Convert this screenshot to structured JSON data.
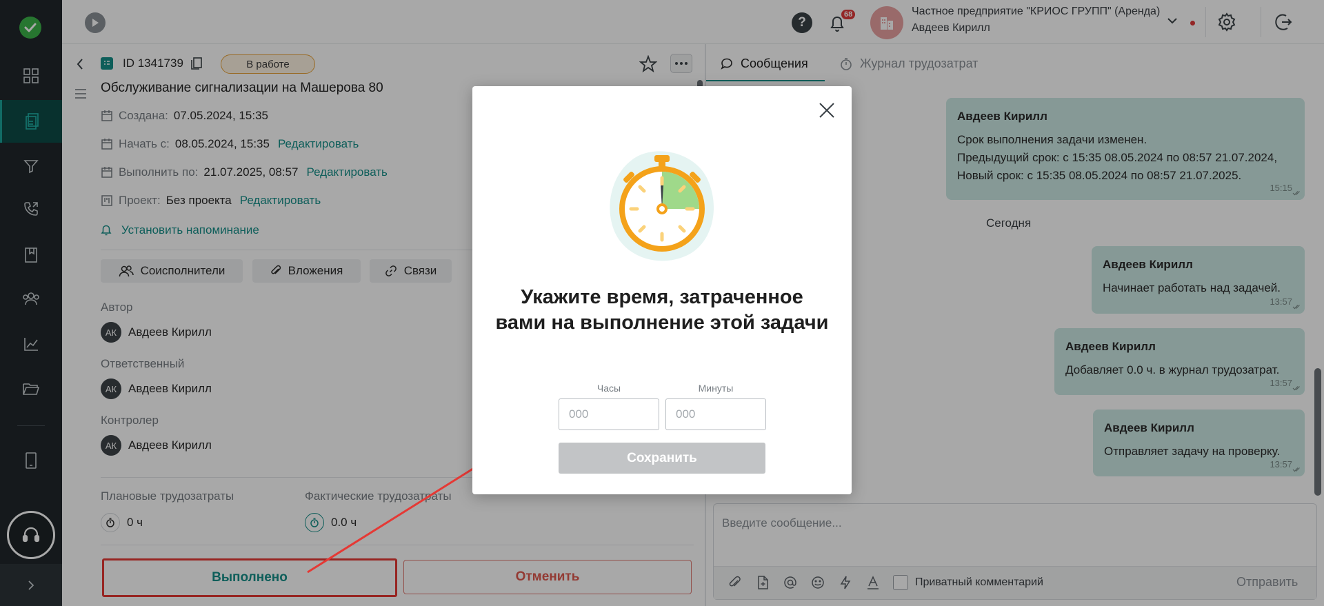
{
  "topbar": {
    "notifications_count": "68",
    "org_name": "Частное предприятие \"КРИОС ГРУПП\" (Аренда)",
    "user_name": "Авдеев Кирилл"
  },
  "task": {
    "id_text": "ID 1341739",
    "status": "В работе",
    "title": "Обслуживание сигнализации на Машерова 80",
    "created_label": "Создана:",
    "created_value": "07.05.2024, 15:35",
    "start_label": "Начать с:",
    "start_value": "08.05.2024, 15:35",
    "due_label": "Выполнить по:",
    "due_value": "21.07.2025, 08:57",
    "project_label": "Проект:",
    "project_value": "Без проекта",
    "edit_link": "Редактировать",
    "reminder": "Установить напоминание",
    "tabs": [
      "Соисполнители",
      "Вложения",
      "Связи"
    ],
    "author_label": "Автор",
    "responsible_label": "Ответственный",
    "controller_label": "Контролер",
    "person_initials": "АК",
    "person_name": "Авдеев Кирилл",
    "planned_label": "Плановые трудозатраты",
    "planned_value": "0 ч",
    "actual_label": "Фактические трудозатраты",
    "actual_value": "0.0 ч",
    "done_button": "Выполнено",
    "cancel_button": "Отменить"
  },
  "chat": {
    "tab_messages": "Сообщения",
    "tab_journal": "Журнал трудозатрат",
    "day_label": "Сегодня",
    "messages": [
      {
        "author": "Авдеев Кирилл",
        "lines": [
          "Срок выполнения задачи изменен.",
          "Предыдущий срок: с 15:35 08.05.2024 по 08:57 21.07.2024,",
          "Новый срок: с 15:35 08.05.2024 по 08:57 21.07.2025."
        ],
        "time": "15:15"
      },
      {
        "author": "Авдеев Кирилл",
        "lines": [
          "Начинает работать над задачей."
        ],
        "time": "13:57"
      },
      {
        "author": "Авдеев Кирилл",
        "lines": [
          "Добавляет 0.0 ч. в журнал трудозатрат."
        ],
        "time": "13:57"
      },
      {
        "author": "Авдеев Кирилл",
        "lines": [
          "Отправляет задачу на проверку."
        ],
        "time": "13:57"
      }
    ],
    "composer_placeholder": "Введите сообщение...",
    "private_label": "Приватный комментарий",
    "send_label": "Отправить"
  },
  "modal": {
    "title": "Укажите время, затраченное вами на выполнение этой задачи",
    "hours_label": "Часы",
    "minutes_label": "Минуты",
    "hours_placeholder": "000",
    "minutes_placeholder": "000",
    "save_button": "Сохранить"
  },
  "colors": {
    "accent": "#168f89",
    "danger": "#e53935",
    "bubble": "#cce8e4",
    "rail": "#20272b"
  }
}
